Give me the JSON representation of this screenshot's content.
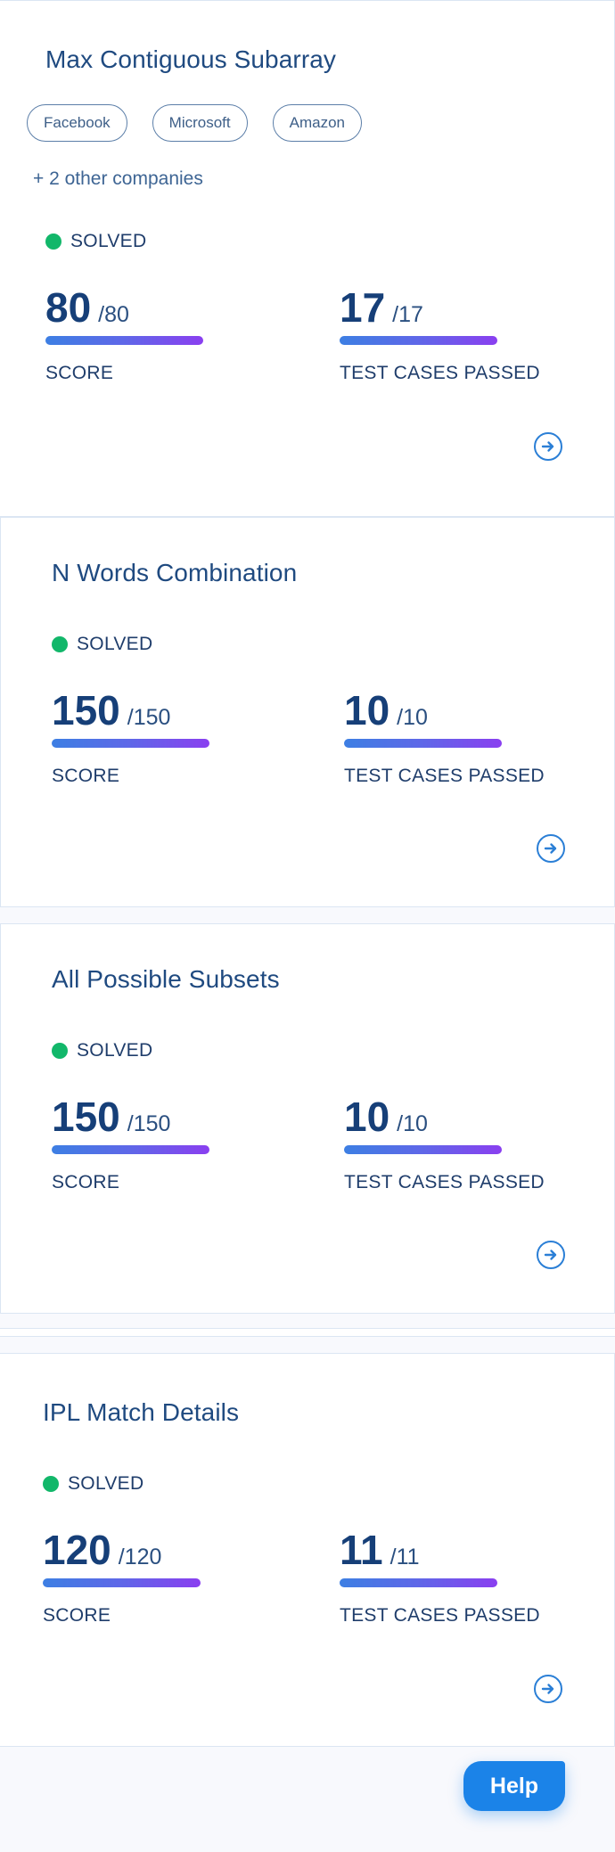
{
  "cards": [
    {
      "title": "Max Contiguous Subarray",
      "companies": [
        "Facebook",
        "Microsoft",
        "Amazon"
      ],
      "more_companies": "+ 2 other companies",
      "status": "SOLVED",
      "score": {
        "value": "80",
        "out_of": "/80",
        "label": "SCORE"
      },
      "tests": {
        "value": "17",
        "out_of": "/17",
        "label": "TEST CASES PASSED"
      }
    },
    {
      "title": "N Words Combination",
      "status": "SOLVED",
      "score": {
        "value": "150",
        "out_of": "/150",
        "label": "SCORE"
      },
      "tests": {
        "value": "10",
        "out_of": "/10",
        "label": "TEST CASES PASSED"
      }
    },
    {
      "title": "All Possible Subsets",
      "status": "SOLVED",
      "score": {
        "value": "150",
        "out_of": "/150",
        "label": "SCORE"
      },
      "tests": {
        "value": "10",
        "out_of": "/10",
        "label": "TEST CASES PASSED"
      }
    },
    {
      "title": "IPL Match Details",
      "status": "SOLVED",
      "score": {
        "value": "120",
        "out_of": "/120",
        "label": "SCORE"
      },
      "tests": {
        "value": "11",
        "out_of": "/11",
        "label": "TEST CASES PASSED"
      }
    }
  ],
  "help_label": "Help",
  "colors": {
    "solved": "#12b76a",
    "accent": "#1b83e8",
    "bar_start": "#3d7fe3",
    "bar_end": "#8a3ff0"
  },
  "icons": {
    "open": "arrow-right-circle-icon",
    "status": "status-dot-icon"
  }
}
